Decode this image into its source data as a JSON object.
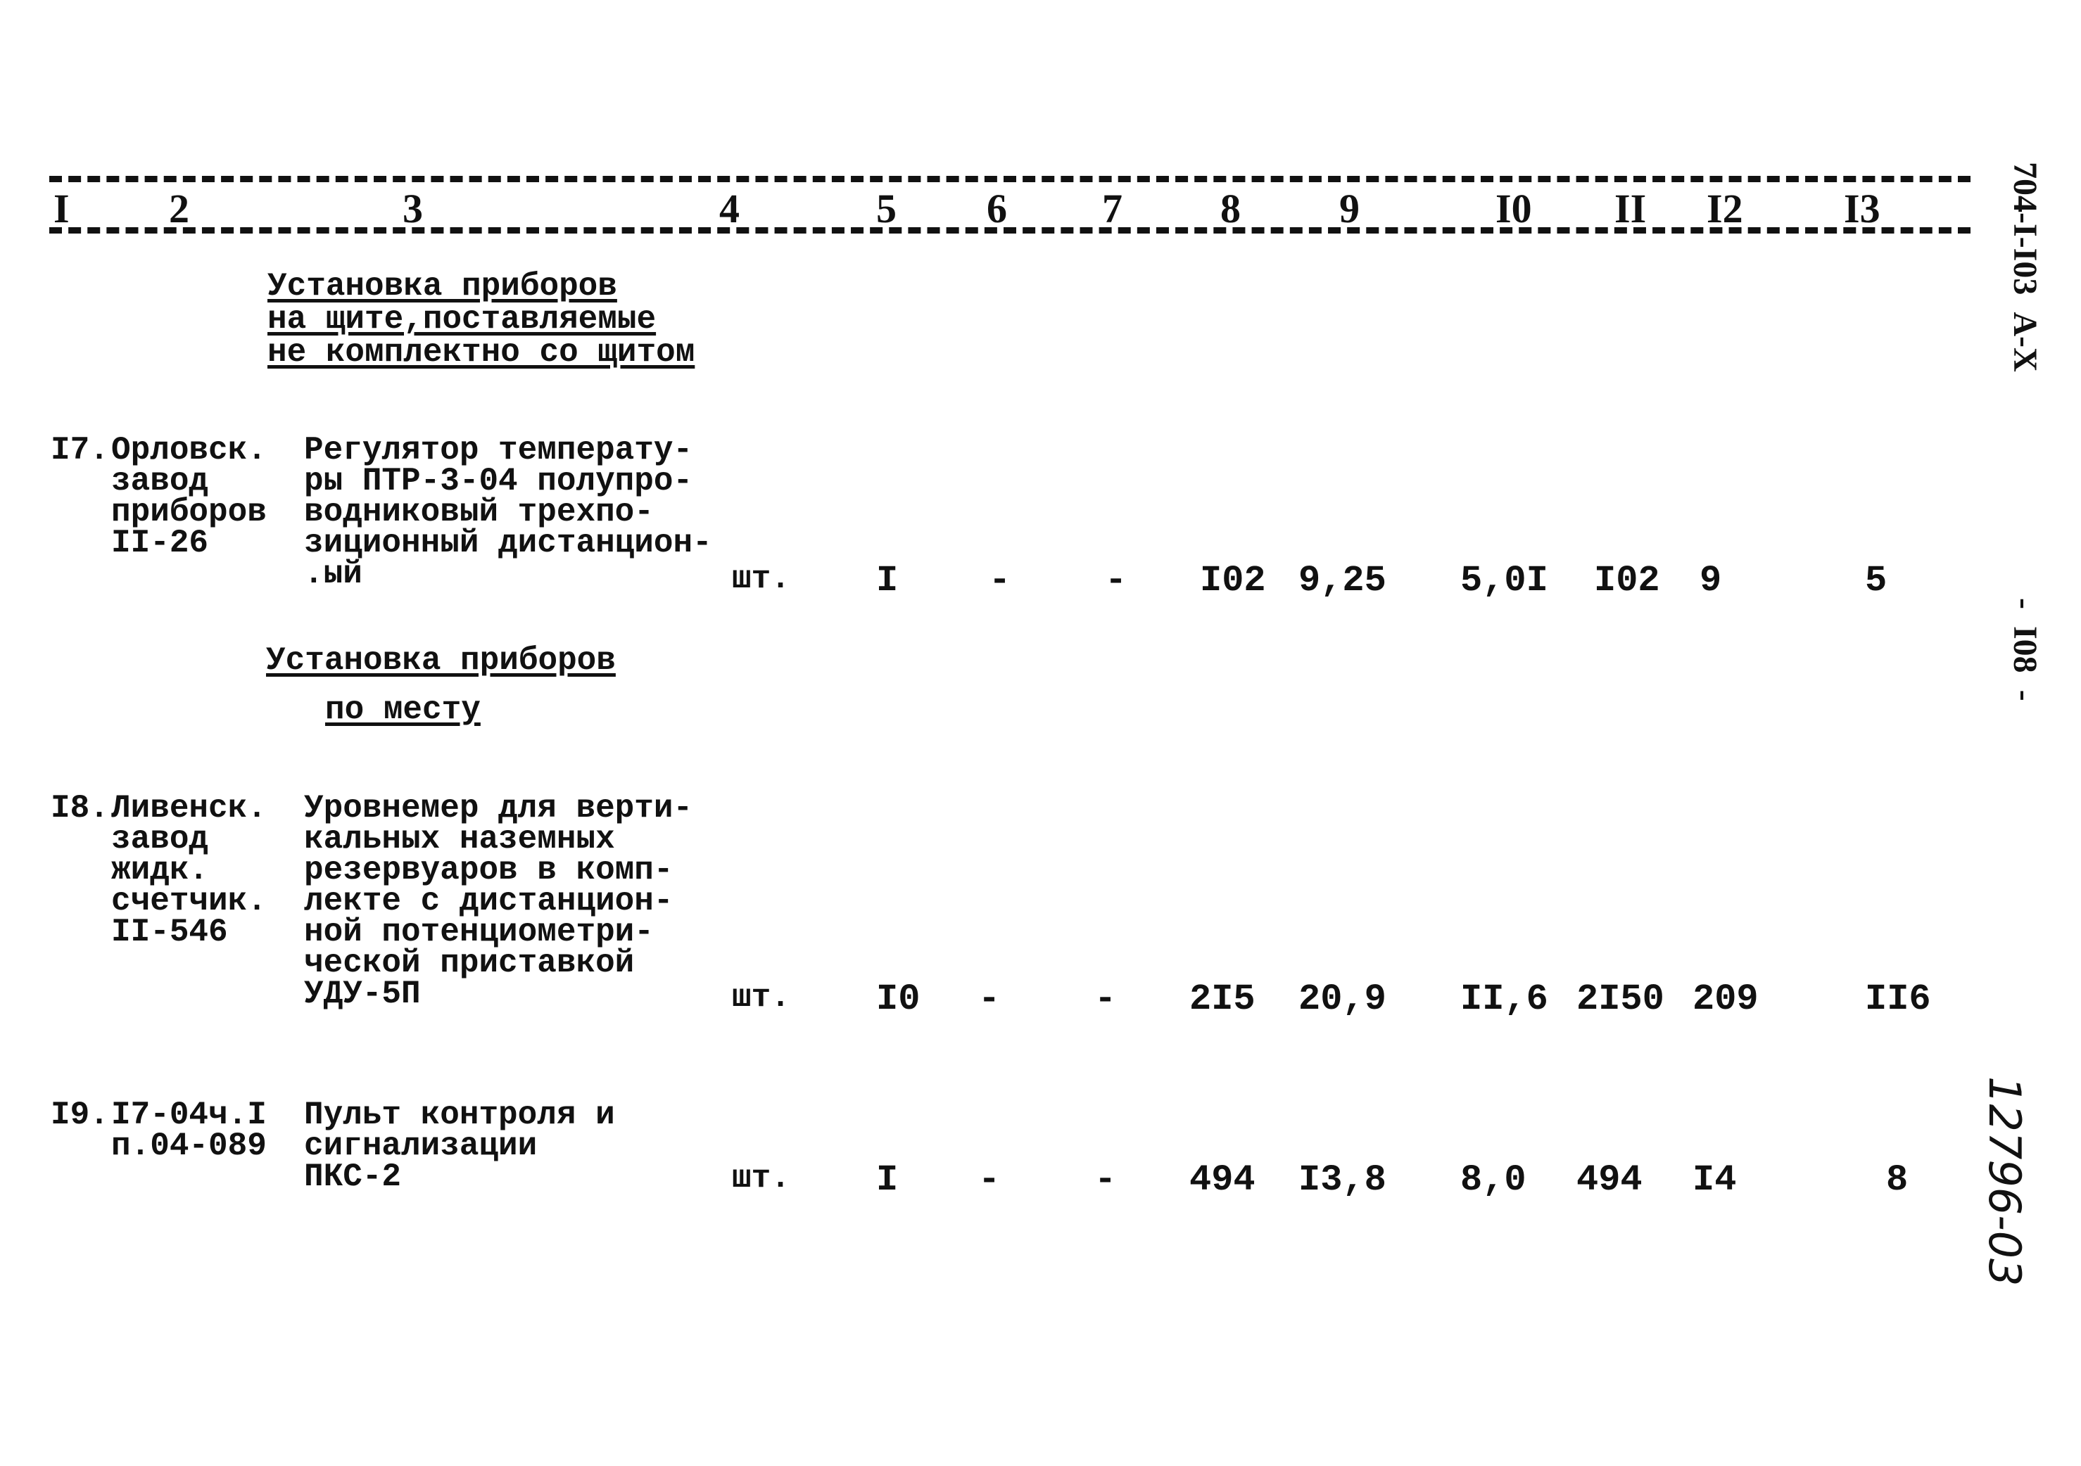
{
  "columns": [
    "I",
    "2",
    "3",
    "4",
    "5",
    "6",
    "7",
    "8",
    "9",
    "I0",
    "II",
    "I2",
    "I3"
  ],
  "sections": [
    {
      "title_lines": [
        "Установка приборов",
        "на щите,поставляемые",
        "не комплектно со щитом"
      ]
    },
    {
      "title_lines": [
        "Установка приборов",
        "по месту"
      ]
    }
  ],
  "rows": [
    {
      "number": "I7.",
      "source_lines": [
        "Орловск.",
        "завод",
        "приборов",
        "II-26"
      ],
      "description_lines": [
        "Регулятор температу-",
        "ры ПТР-3-04 полупро-",
        "водниковый трехпо-",
        "зиционный дистанцион-",
        ".ый"
      ],
      "unit": "шт.",
      "c5": "I",
      "c6": "-",
      "c7": "-",
      "c8": "I02",
      "c9": "9,25",
      "c10": "5,0I",
      "c11": "I02",
      "c12": "9",
      "c13": "5"
    },
    {
      "number": "I8.",
      "source_lines": [
        "Ливенск.",
        "завод",
        "жидк.",
        "счетчик.",
        "II-546"
      ],
      "description_lines": [
        "Уровнемер для верти-",
        "кальных наземных",
        "резервуаров в комп-",
        "лекте с дистанцион-",
        "ной потенциометри-",
        "ческой приставкой",
        "УДУ-5П"
      ],
      "unit": "шт.",
      "c5": "I0",
      "c6": "-",
      "c7": "-",
      "c8": "2I5",
      "c9": "20,9",
      "c10": "II,6",
      "c11": "2I50",
      "c12": "209",
      "c13": "II6"
    },
    {
      "number": "I9.",
      "source_lines": [
        "I7-04ч.I",
        "п.04-089"
      ],
      "description_lines": [
        "Пульт контроля и",
        "сигнализации",
        "ПКС-2"
      ],
      "unit": "шт.",
      "c5": "I",
      "c6": "-",
      "c7": "-",
      "c8": "494",
      "c9": "I3,8",
      "c10": "8,0",
      "c11": "494",
      "c12": "I4",
      "c13": "8"
    }
  ],
  "margin": {
    "stamp_top": "704-I-I03  А-Х",
    "stamp_mid": "-  I08  -",
    "handwritten": "12796-03"
  }
}
